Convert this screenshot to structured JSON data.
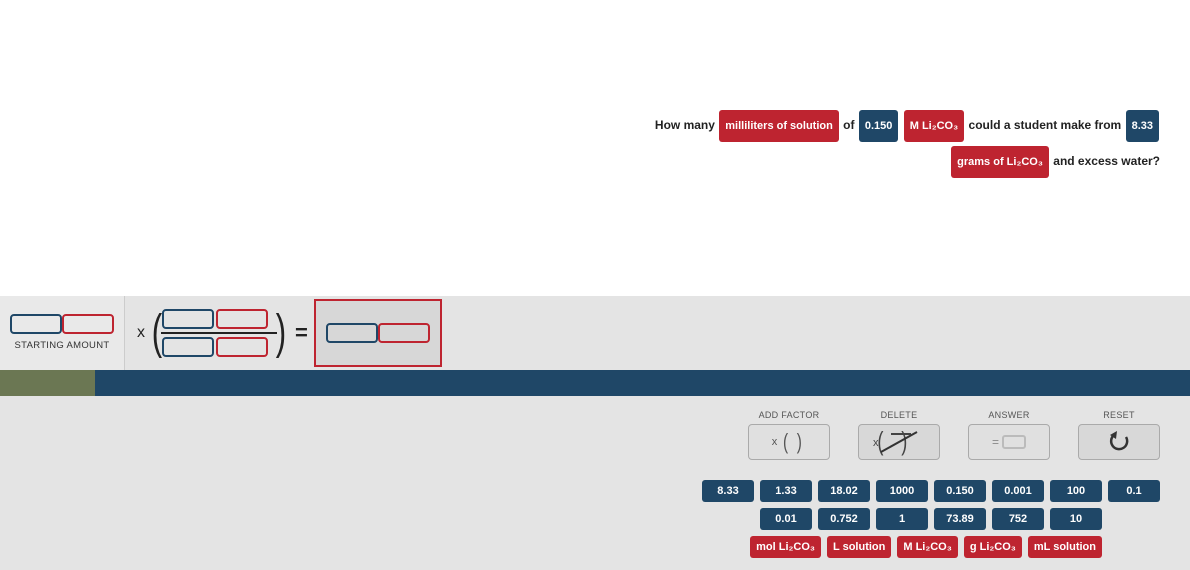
{
  "question": {
    "prefix": "How many",
    "tag1": "milliliters of solution",
    "mid1": "of",
    "tag2": "0.150",
    "tag3": "M Li₂CO₃",
    "mid2": "could a student make from",
    "tag4": "8.33",
    "tag5": "grams of Li₂CO₃",
    "suffix": "and excess water?"
  },
  "starting_label": "STARTING AMOUNT",
  "controls": {
    "add_factor": "ADD FACTOR",
    "delete": "DELETE",
    "answer": "ANSWER",
    "reset": "RESET"
  },
  "values_row1": [
    "8.33",
    "1.33",
    "18.02",
    "1000",
    "0.150",
    "0.001",
    "100",
    "0.1"
  ],
  "values_row2": [
    "0.01",
    "0.752",
    "1",
    "73.89",
    "752",
    "10"
  ],
  "units": [
    "mol Li₂CO₃",
    "L solution",
    "M Li₂CO₃",
    "g Li₂CO₃",
    "mL solution"
  ]
}
